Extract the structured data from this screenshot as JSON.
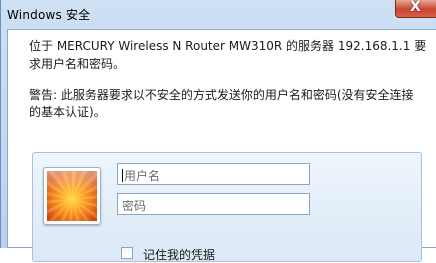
{
  "window": {
    "title": "Windows 安全",
    "close_symbol": "X"
  },
  "message": {
    "line1": "位于 MERCURY Wireless N Router MW310R 的服务器 192.168.1.1 要",
    "line2": "求用户名和密码。",
    "warning_line1": "警告: 此服务器要求以不安全的方式发送你的用户名和密码(没有安全连接",
    "warning_line2": "的基本认证)。"
  },
  "credentials": {
    "avatar_icon": "user-avatar-flower-icon",
    "username_placeholder": "用户名",
    "password_placeholder": "密码",
    "remember_label": "记住我的凭据",
    "remember_checked": false
  }
}
